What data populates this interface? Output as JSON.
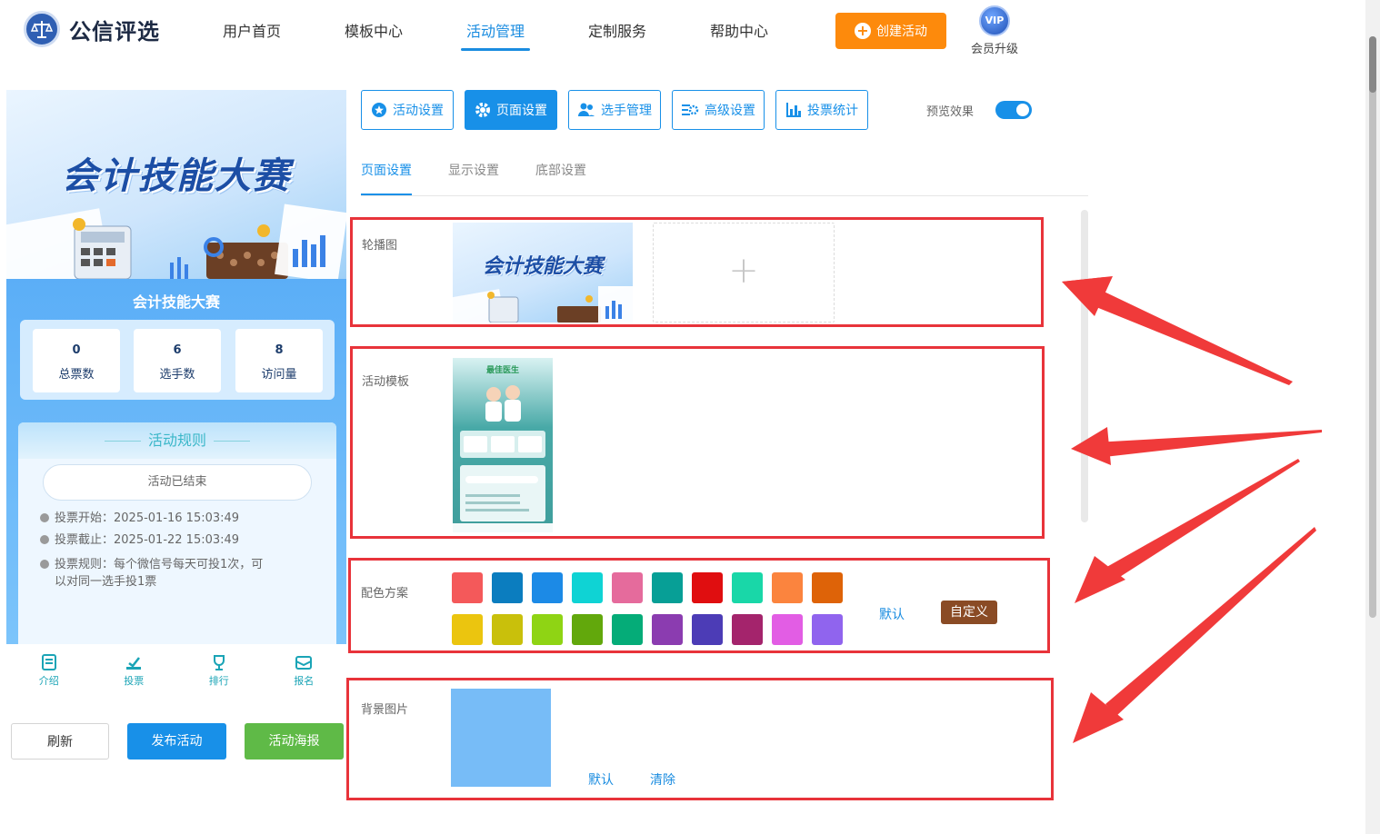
{
  "header": {
    "logo_text": "公信评选",
    "nav": [
      "用户首页",
      "模板中心",
      "活动管理",
      "定制服务",
      "帮助中心"
    ],
    "active_nav": "活动管理",
    "create_button": "创建活动",
    "vip_badge": "VIP",
    "vip_label": "会员升级"
  },
  "preview": {
    "banner_title": "会计技能大赛",
    "activity_title": "会计技能大赛",
    "stats": [
      {
        "value": "0",
        "label": "总票数"
      },
      {
        "value": "6",
        "label": "选手数"
      },
      {
        "value": "8",
        "label": "访问量"
      }
    ],
    "rules_title": "活动规则",
    "status": "活动已结束",
    "rules": [
      "投票开始：2025-01-16 15:03:49",
      "投票截止：2025-01-22 15:03:49",
      "投票规则：每个微信号每天可投1次，可以对同一选手投1票"
    ],
    "tabs": [
      "介绍",
      "投票",
      "排行",
      "报名"
    ]
  },
  "left_buttons": {
    "refresh": "刷新",
    "publish": "发布活动",
    "poster": "活动海报"
  },
  "toolbar": {
    "buttons": [
      "活动设置",
      "页面设置",
      "选手管理",
      "高级设置",
      "投票统计"
    ],
    "active": "页面设置",
    "preview_label": "预览效果",
    "preview_on": true
  },
  "subtabs": [
    "页面设置",
    "显示设置",
    "底部设置"
  ],
  "active_subtab": "页面设置",
  "sections": {
    "carousel": {
      "label": "轮播图",
      "image_title": "会计技能大赛",
      "add_icon": "+"
    },
    "template": {
      "label": "活动模板",
      "thumb_title": "最佳医生"
    },
    "colors": {
      "label": "配色方案",
      "row1": [
        "#f4595a",
        "#0b7dbf",
        "#1c8ae6",
        "#0fd3d4",
        "#e56b9c",
        "#079f96",
        "#e00e10",
        "#19d7a8",
        "#fb843e",
        "#de6308"
      ],
      "row2": [
        "#ebc50f",
        "#c9c00b",
        "#8fd414",
        "#62a80c",
        "#05ac78",
        "#8b3cb0",
        "#4c3cb6",
        "#a4246c",
        "#e25de4",
        "#9064ee"
      ],
      "default_label": "默认",
      "custom_label": "自定义"
    },
    "background": {
      "label": "背景图片",
      "default_label": "默认",
      "clear_label": "清除"
    }
  }
}
